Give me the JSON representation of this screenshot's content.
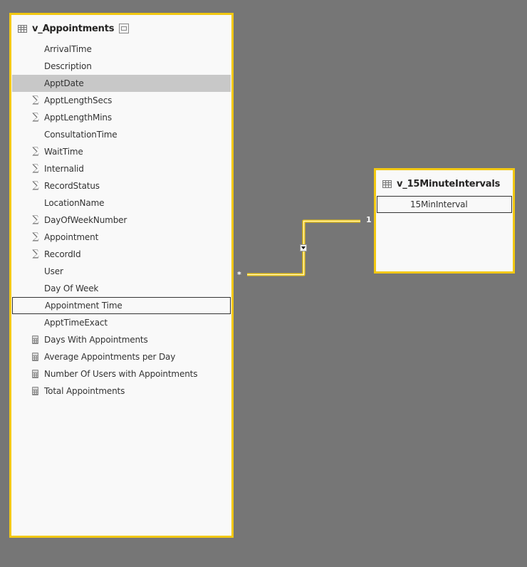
{
  "colors": {
    "canvas_background": "#767676",
    "card_border_selected": "#f2c811",
    "card_background": "#f9f9f9",
    "row_hover": "#c8c8c8",
    "relationship_line": "#f2c811"
  },
  "tables": {
    "appointments": {
      "title": "v_Appointments",
      "header_icon": "table-icon",
      "collapse_icon": "collapse-icon",
      "fields": [
        {
          "label": "ArrivalTime",
          "icon": "none",
          "state": ""
        },
        {
          "label": "Description",
          "icon": "none",
          "state": ""
        },
        {
          "label": "ApptDate",
          "icon": "none",
          "state": "hover"
        },
        {
          "label": "ApptLengthSecs",
          "icon": "sigma-icon",
          "state": ""
        },
        {
          "label": "ApptLengthMins",
          "icon": "sigma-icon",
          "state": ""
        },
        {
          "label": "ConsultationTime",
          "icon": "none",
          "state": ""
        },
        {
          "label": "WaitTime",
          "icon": "sigma-icon",
          "state": ""
        },
        {
          "label": "Internalid",
          "icon": "sigma-icon",
          "state": ""
        },
        {
          "label": "RecordStatus",
          "icon": "sigma-icon",
          "state": ""
        },
        {
          "label": "LocationName",
          "icon": "none",
          "state": ""
        },
        {
          "label": "DayOfWeekNumber",
          "icon": "sigma-icon",
          "state": ""
        },
        {
          "label": "Appointment",
          "icon": "sigma-icon",
          "state": ""
        },
        {
          "label": "RecordId",
          "icon": "sigma-icon",
          "state": ""
        },
        {
          "label": "User",
          "icon": "none",
          "state": ""
        },
        {
          "label": "Day Of Week",
          "icon": "none",
          "state": ""
        },
        {
          "label": "Appointment Time",
          "icon": "none",
          "state": "selected"
        },
        {
          "label": "ApptTimeExact",
          "icon": "none",
          "state": ""
        },
        {
          "label": "Days With Appointments",
          "icon": "calculator-icon",
          "state": ""
        },
        {
          "label": "Average Appointments per Day",
          "icon": "calculator-icon",
          "state": ""
        },
        {
          "label": "Number Of Users with Appointments",
          "icon": "calculator-icon",
          "state": ""
        },
        {
          "label": "Total Appointments",
          "icon": "calculator-icon",
          "state": ""
        }
      ]
    },
    "intervals": {
      "title": "v_15MinuteIntervals",
      "header_icon": "table-icon",
      "fields": [
        {
          "label": "15MinInterval",
          "icon": "none",
          "state": "selected"
        }
      ]
    }
  },
  "relationship": {
    "from_table": "v_Appointments",
    "from_field": "Appointment Time",
    "to_table": "v_15MinuteIntervals",
    "to_field": "15MinInterval",
    "many_side_label": "*",
    "one_side_label": "1",
    "cross_filter_direction": "single"
  }
}
